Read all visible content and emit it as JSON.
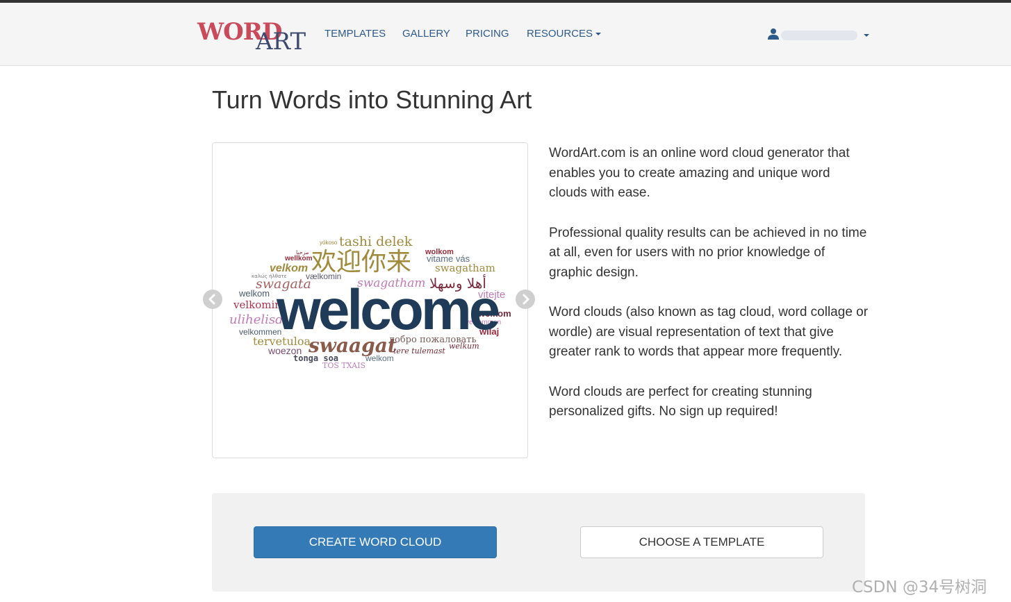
{
  "nav": {
    "logo_word": "WORD",
    "logo_art": "ART",
    "items": [
      {
        "label": "TEMPLATES"
      },
      {
        "label": "GALLERY"
      },
      {
        "label": "PRICING"
      },
      {
        "label": "RESOURCES"
      }
    ],
    "user_icon": "user-icon",
    "user_name": ""
  },
  "page": {
    "title": "Turn Words into Stunning Art"
  },
  "carousel": {
    "main_word": "welcome",
    "words": [
      "tashi delek",
      "欢迎你来",
      "vitame vás",
      "swagatham",
      "wellkom",
      "velkom",
      "swagata",
      "vælkomin",
      "swagatham",
      "أهلا وسهلا",
      "welkom",
      "velkomin",
      "vitejte",
      "ulihelisdi",
      "welkom",
      "velkommen",
      "wilaj",
      "velkommen",
      "tervetuloa",
      "swaagat",
      "добро пожаловать",
      "woezon",
      "tere tulemast",
      "welkum",
      "tonga soa",
      "welkom",
      "TOS TXAIS",
      "yókoso",
      "wolkom",
      "مرحبا",
      "καλώς ήλθατε"
    ],
    "prev_icon": "chevron-left-icon",
    "next_icon": "chevron-right-icon"
  },
  "description": {
    "p1": "WordArt.com is an online word cloud generator that enables you to create amazing and unique word clouds with ease.",
    "p2": "Professional quality results can be achieved in no time at all, even for users with no prior knowledge of graphic design.",
    "p3": "Word clouds (also known as tag cloud, word collage or wordle) are visual representation of text that give greater rank to words that appear more frequently.",
    "p4": "Word clouds are perfect for creating stunning personalized gifts. No sign up required!"
  },
  "cta": {
    "create_label": "CREATE WORD CLOUD",
    "template_label": "CHOOSE A TEMPLATE"
  },
  "watermark": "CSDN @34号树洞",
  "colors": {
    "nav_link": "#2e5a8a",
    "primary": "#337ab7",
    "logo_red": "#c94a5b",
    "logo_navy": "#3d4a6e",
    "cloud_main": "#1f3b57"
  }
}
